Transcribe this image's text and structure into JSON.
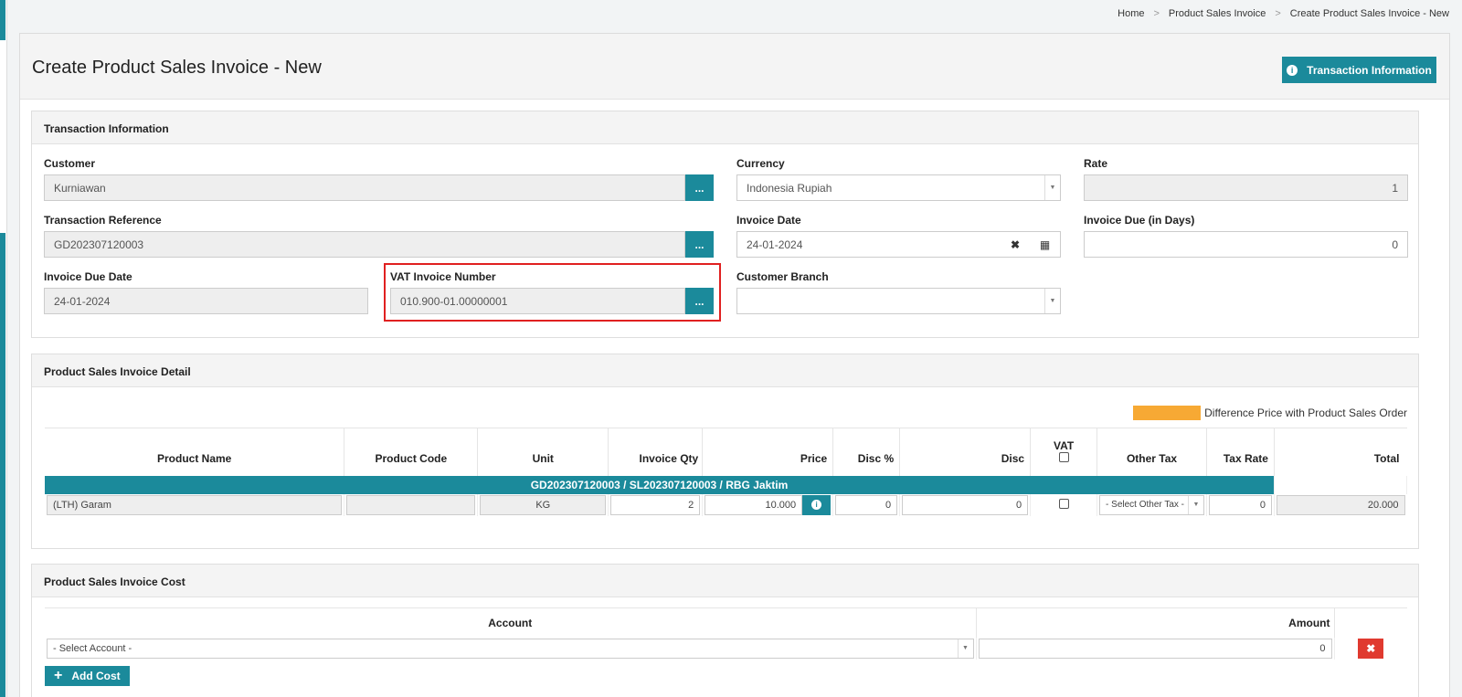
{
  "breadcrumb": [
    "Home",
    "Product Sales Invoice",
    "Create Product Sales Invoice - New"
  ],
  "page": {
    "title": "Create Product Sales Invoice - New",
    "info_button": "Transaction Information"
  },
  "transaction": {
    "panel_title": "Transaction Information",
    "customer_label": "Customer",
    "customer_value": "Kurniawan",
    "currency_label": "Currency",
    "currency_value": "Indonesia Rupiah",
    "rate_label": "Rate",
    "rate_value": "1",
    "reference_label": "Transaction Reference",
    "reference_value": "GD202307120003",
    "invoice_date_label": "Invoice Date",
    "invoice_date_value": "24-01-2024",
    "invoice_due_label": "Invoice Due (in Days)",
    "invoice_due_value": "0",
    "due_date_label": "Invoice Due Date",
    "due_date_value": "24-01-2024",
    "vat_label": "VAT Invoice Number",
    "vat_value": "010.900-01.00000001",
    "branch_label": "Customer Branch",
    "branch_value": "",
    "lookup_button": "..."
  },
  "detail": {
    "panel_title": "Product Sales Invoice Detail",
    "legend_label": "Difference Price with Product Sales Order",
    "legend_color": "#f7a934",
    "columns": [
      "Product Name",
      "Product Code",
      "Unit",
      "Invoice Qty",
      "Price",
      "Disc %",
      "Disc",
      "VAT",
      "Other Tax",
      "Tax Rate",
      "Total"
    ],
    "group_label": "GD202307120003 / SL202307120003 / RBG Jaktim",
    "row": {
      "product_name": "(LTH) Garam",
      "product_code": "",
      "unit": "KG",
      "qty": "2",
      "price": "10.000",
      "disc_pct": "0",
      "disc": "0",
      "other_tax": "- Select Other Tax -",
      "tax_rate": "0",
      "total": "20.000"
    }
  },
  "cost": {
    "panel_title": "Product Sales Invoice Cost",
    "account_header": "Account",
    "amount_header": "Amount",
    "account_placeholder": "- Select Account -",
    "amount_value": "0",
    "delete_label": "✖",
    "add_label": "Add Cost"
  },
  "colors": {
    "primary": "#1b8a9b",
    "danger": "#e03a2f",
    "highlight": "#e02020"
  }
}
